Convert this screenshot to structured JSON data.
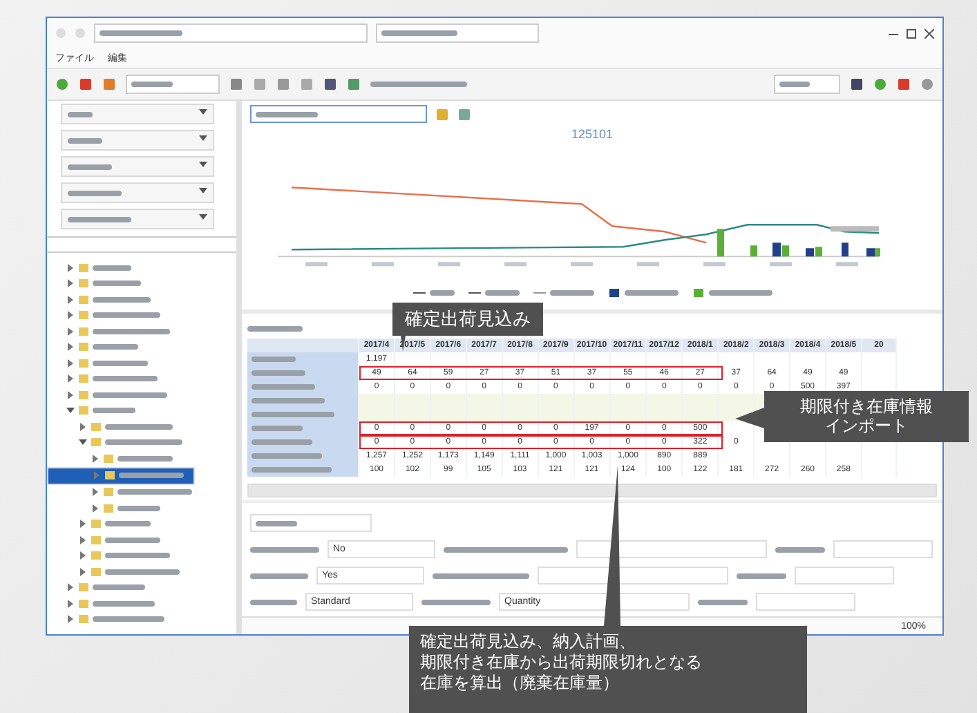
{
  "menu": [
    {
      "label": "ファイル"
    },
    {
      "label": "編集"
    }
  ],
  "chart": {
    "title": "125101"
  },
  "table": {
    "columns": [
      "2017/4",
      "2017/5",
      "2017/6",
      "2017/7",
      "2017/8",
      "2017/9",
      "2017/10",
      "2017/11",
      "2017/12",
      "2018/1",
      "2018/2",
      "2018/3",
      "2018/4",
      "2018/5",
      "20"
    ],
    "rows": [
      {
        "boxed": false,
        "cells": [
          "1,197"
        ]
      },
      {
        "boxed": true,
        "cells": [
          "49",
          "64",
          "59",
          "27",
          "37",
          "51",
          "37",
          "55",
          "46",
          "27",
          "37",
          "64",
          "49",
          "49"
        ]
      },
      {
        "boxed": false,
        "cells": [
          "0",
          "0",
          "0",
          "0",
          "0",
          "0",
          "0",
          "0",
          "0",
          "0",
          "0",
          "0",
          "500",
          "397"
        ]
      },
      {
        "boxed": false,
        "cells": []
      },
      {
        "boxed": false,
        "cells": []
      },
      {
        "boxed": true,
        "cells": [
          "0",
          "0",
          "0",
          "0",
          "0",
          "0",
          "197",
          "0",
          "0",
          "500"
        ]
      },
      {
        "boxed": true,
        "cells": [
          "0",
          "0",
          "0",
          "0",
          "0",
          "0",
          "0",
          "0",
          "0",
          "322",
          "0"
        ]
      },
      {
        "boxed": false,
        "cells": [
          "1,257",
          "1,252",
          "1,173",
          "1,149",
          "1,111",
          "1,000",
          "1,003",
          "1,000",
          "890",
          "889"
        ]
      },
      {
        "boxed": false,
        "cells": [
          "100",
          "102",
          "99",
          "105",
          "103",
          "121",
          "121",
          "124",
          "100",
          "122",
          "181",
          "272",
          "260",
          "258"
        ]
      }
    ]
  },
  "tree": [
    {
      "expanded": false,
      "selected": false
    },
    {
      "expanded": false,
      "selected": false
    },
    {
      "expanded": false,
      "selected": false
    },
    {
      "expanded": false,
      "selected": false
    },
    {
      "expanded": false,
      "selected": false
    },
    {
      "expanded": false,
      "selected": false
    },
    {
      "expanded": false,
      "selected": false
    },
    {
      "expanded": false,
      "selected": false
    },
    {
      "expanded": false,
      "selected": false
    },
    {
      "expanded": true,
      "selected": false,
      "children": [
        {
          "expanded": false,
          "selected": false
        },
        {
          "expanded": true,
          "selected": false,
          "children": [
            {
              "expanded": false,
              "selected": false
            },
            {
              "expanded": false,
              "selected": true
            },
            {
              "expanded": false,
              "selected": false
            },
            {
              "expanded": false,
              "selected": false
            }
          ]
        },
        {
          "expanded": false,
          "selected": false
        },
        {
          "expanded": false,
          "selected": false
        },
        {
          "expanded": false,
          "selected": false
        },
        {
          "expanded": false,
          "selected": false
        }
      ]
    },
    {
      "expanded": false,
      "selected": false
    },
    {
      "expanded": false,
      "selected": false
    },
    {
      "expanded": false,
      "selected": false
    }
  ],
  "form": {
    "rows": [
      {
        "value_1": "No",
        "value_2": ""
      },
      {
        "value_1": "Yes",
        "value_2": ""
      },
      {
        "value_1": "Standard",
        "value_2": "Quantity"
      }
    ]
  },
  "status_bar": {
    "zoom": "100%"
  },
  "callouts": [
    {
      "lines": [
        "確定出荷見込み"
      ]
    },
    {
      "lines": [
        "期限付き在庫情報",
        "インポート"
      ]
    },
    {
      "lines": [
        "確定出荷見込み、納入計画、",
        "期限付き在庫から出荷期限切れとなる",
        "在庫を算出（廃棄在庫量）"
      ]
    }
  ]
}
